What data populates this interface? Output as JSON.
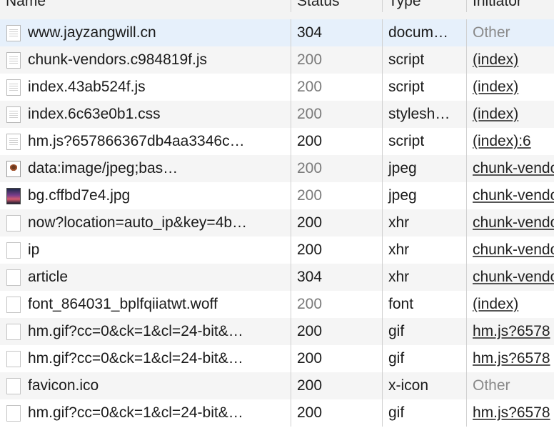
{
  "header": {
    "name": "Name",
    "status": "Status",
    "type": "Type",
    "initiator": "Initiator"
  },
  "rows": [
    {
      "name": "www.jayzangwill.cn",
      "status": "304",
      "type": "docum…",
      "initiator": "Other",
      "icon": "document-icon"
    },
    {
      "name": "chunk-vendors.c984819f.js",
      "status": "200",
      "type": "script",
      "initiator": "(index)",
      "icon": "document-icon"
    },
    {
      "name": "index.43ab524f.js",
      "status": "200",
      "type": "script",
      "initiator": "(index)",
      "icon": "document-icon"
    },
    {
      "name": "index.6c63e0b1.css",
      "status": "200",
      "type": "stylesh…",
      "initiator": "(index)",
      "icon": "document-icon"
    },
    {
      "name": "hm.js?657866367db4aa3346c…",
      "status": "200",
      "type": "script",
      "initiator": "(index):6",
      "icon": "document-icon"
    },
    {
      "name": "data:image/jpeg;bas…",
      "status": "200",
      "type": "jpeg",
      "initiator": "chunk-vendors",
      "icon": "image-thumbnail-icon"
    },
    {
      "name": "bg.cffbd7e4.jpg",
      "status": "200",
      "type": "jpeg",
      "initiator": "chunk-vendors",
      "icon": "image-thumbnail-icon"
    },
    {
      "name": "now?location=auto_ip&key=4b…",
      "status": "200",
      "type": "xhr",
      "initiator": "chunk-vendors",
      "icon": "blank-file-icon"
    },
    {
      "name": "ip",
      "status": "200",
      "type": "xhr",
      "initiator": "chunk-vendors",
      "icon": "blank-file-icon"
    },
    {
      "name": "article",
      "status": "304",
      "type": "xhr",
      "initiator": "chunk-vendors",
      "icon": "blank-file-icon"
    },
    {
      "name": "font_864031_bplfqiiatwt.woff",
      "status": "200",
      "type": "font",
      "initiator": "(index)",
      "icon": "blank-file-icon"
    },
    {
      "name": "hm.gif?cc=0&ck=1&cl=24-bit&…",
      "status": "200",
      "type": "gif",
      "initiator": "hm.js?6578",
      "icon": "blank-file-icon"
    },
    {
      "name": "hm.gif?cc=0&ck=1&cl=24-bit&…",
      "status": "200",
      "type": "gif",
      "initiator": "hm.js?6578",
      "icon": "blank-file-icon"
    },
    {
      "name": "favicon.ico",
      "status": "200",
      "type": "x-icon",
      "initiator": "Other",
      "icon": "blank-file-icon"
    },
    {
      "name": "hm.gif?cc=0&ck=1&cl=24-bit&…",
      "status": "200",
      "type": "gif",
      "initiator": "hm.js?6578",
      "icon": "blank-file-icon"
    }
  ]
}
